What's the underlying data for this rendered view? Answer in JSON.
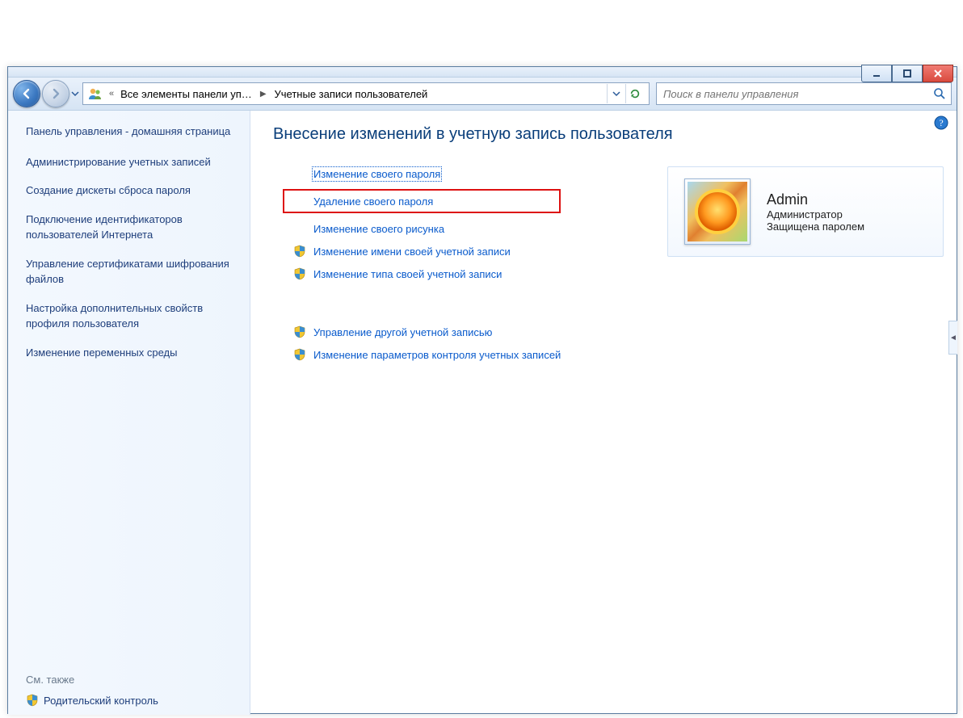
{
  "window_buttons": {
    "min": "min",
    "max": "max",
    "close": "close"
  },
  "breadcrumb": {
    "segment1": "Все элементы панели уп…",
    "segment2": "Учетные записи пользователей"
  },
  "search": {
    "placeholder": "Поиск в панели управления"
  },
  "sidebar": {
    "home": "Панель управления - домашняя страница",
    "links": [
      "Администрирование учетных записей",
      "Создание дискеты сброса пароля",
      "Подключение идентификаторов пользователей Интернета",
      "Управление сертификатами шифрования файлов",
      "Настройка дополнительных свойств профиля пользователя",
      "Изменение переменных среды"
    ],
    "see_also_header": "См. также",
    "see_also_link": "Родительский контроль"
  },
  "heading": "Внесение изменений в учетную запись пользователя",
  "tasks": [
    {
      "label": "Изменение своего пароля",
      "shield": false,
      "dotted": true,
      "boxed": false
    },
    {
      "label": "Удаление своего пароля",
      "shield": false,
      "dotted": false,
      "boxed": true
    },
    {
      "label": "Изменение своего рисунка",
      "shield": false,
      "dotted": false,
      "boxed": false
    },
    {
      "label": "Изменение имени своей учетной записи",
      "shield": true,
      "dotted": false,
      "boxed": false
    },
    {
      "label": "Изменение типа своей учетной записи",
      "shield": true,
      "dotted": false,
      "boxed": false
    }
  ],
  "tasks2": [
    {
      "label": "Управление другой учетной записью",
      "shield": true
    },
    {
      "label": "Изменение параметров контроля учетных записей",
      "shield": true
    }
  ],
  "account": {
    "name": "Admin",
    "role": "Администратор",
    "protection": "Защищена паролем"
  }
}
